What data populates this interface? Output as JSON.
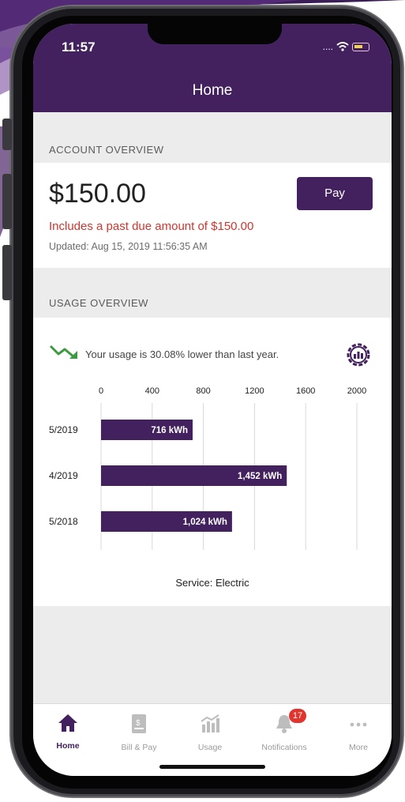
{
  "status_bar": {
    "time": "11:57",
    "signal": "....",
    "wifi_icon": "wifi-icon",
    "battery_icon": "battery-charging-icon"
  },
  "header": {
    "title": "Home"
  },
  "account_overview": {
    "section_label": "ACCOUNT OVERVIEW",
    "amount": "$150.00",
    "pay_button": "Pay",
    "past_due": "Includes a past due amount of $150.00",
    "updated": "Updated: Aug 15, 2019 11:56:35 AM"
  },
  "usage_overview": {
    "section_label": "USAGE OVERVIEW",
    "trend_icon": "trending-down-arrow-icon",
    "trend_text": "Your usage is 30.08% lower than last year.",
    "settings_icon": "gear-chart-icon",
    "service": "Service: Electric"
  },
  "chart_data": {
    "type": "bar",
    "orientation": "horizontal",
    "categories": [
      "5/2019",
      "4/2019",
      "5/2018"
    ],
    "values": [
      716,
      1452,
      1024
    ],
    "value_labels": [
      "716 kWh",
      "1,452 kWh",
      "1,024 kWh"
    ],
    "x_ticks": [
      "0",
      "400",
      "800",
      "1200",
      "1600",
      "2000"
    ],
    "xlim": [
      0,
      2000
    ],
    "grid": true,
    "bar_color": "#43205e"
  },
  "tabbar": {
    "tabs": [
      {
        "label": "Home",
        "icon": "home-icon",
        "active": true
      },
      {
        "label": "Bill & Pay",
        "icon": "bill-document-icon",
        "active": false
      },
      {
        "label": "Usage",
        "icon": "usage-chart-icon",
        "active": false
      },
      {
        "label": "Notifications",
        "icon": "bell-icon",
        "active": false,
        "badge": "17"
      },
      {
        "label": "More",
        "icon": "more-dots-icon",
        "active": false
      }
    ]
  },
  "colors": {
    "brand": "#43205e",
    "alert": "#d4342c",
    "trend_green": "#3c9a3f"
  }
}
